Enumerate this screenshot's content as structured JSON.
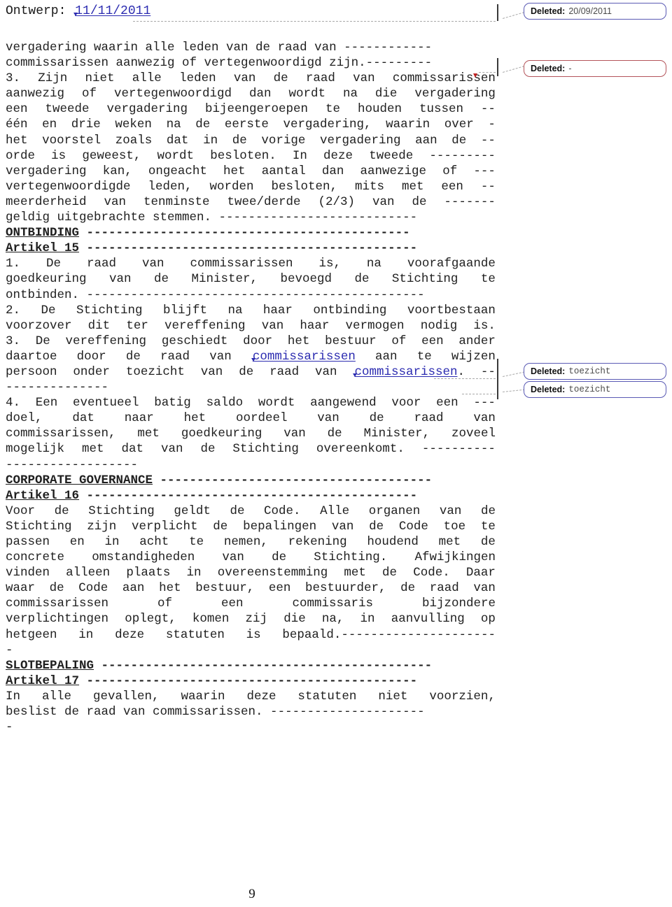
{
  "document": {
    "header": {
      "label": "Ontwerp:",
      "inserted_date": "11/11/2011"
    },
    "page_number": "9",
    "lines": [
      {
        "id": "l01",
        "type": "plain",
        "text": "vergadering waarin alle leden van de raad van ------------"
      },
      {
        "id": "l02",
        "type": "plain",
        "text": "commissarissen aanwezig of vertegenwoordigd zijn.---------"
      },
      {
        "id": "l03",
        "type": "justify",
        "words": [
          "3.",
          "Zijn",
          "niet",
          "alle",
          "leden",
          "van",
          "de",
          "raad",
          "van",
          "commissarissen"
        ]
      },
      {
        "id": "l04",
        "type": "justify",
        "words": [
          "aanwezig",
          "of",
          "vertegenwoordigd",
          "dan",
          "wordt",
          "na",
          "die",
          "vergadering"
        ]
      },
      {
        "id": "l05",
        "type": "justify",
        "words": [
          "een",
          "tweede",
          "vergadering",
          "bijeengeroepen",
          "te",
          "houden",
          "tussen",
          "--"
        ]
      },
      {
        "id": "l06",
        "type": "justify",
        "words": [
          "één",
          "en",
          "drie",
          "weken",
          "na",
          "de",
          "eerste",
          "vergadering,",
          "waarin",
          "over",
          "-"
        ]
      },
      {
        "id": "l07",
        "type": "justify",
        "words": [
          "het",
          "voorstel",
          "zoals",
          "dat",
          "in",
          "de",
          "vorige",
          "vergadering",
          "aan",
          "de",
          "--"
        ]
      },
      {
        "id": "l08",
        "type": "justify",
        "words": [
          "orde",
          "is",
          "geweest,",
          "wordt",
          "besloten.",
          "In",
          "deze",
          "tweede",
          "---------"
        ]
      },
      {
        "id": "l09",
        "type": "justify",
        "words": [
          "vergadering",
          "kan,",
          "ongeacht",
          "het",
          "aantal",
          "dan",
          "aanwezige",
          "of",
          "---"
        ]
      },
      {
        "id": "l10",
        "type": "justify",
        "words": [
          "vertegenwoordigde",
          "leden,",
          "worden",
          "besloten,",
          "mits",
          "met",
          "een",
          "--"
        ]
      },
      {
        "id": "l11",
        "type": "justify",
        "words": [
          "meerderheid",
          "van",
          "tenminste",
          "twee/derde",
          "(2/3)",
          "van",
          "de",
          "-------"
        ]
      },
      {
        "id": "l12",
        "type": "plain",
        "text": "geldig uitgebrachte stemmen. ---------------------------"
      },
      {
        "id": "l13",
        "type": "heading",
        "heading": "ONTBINDING",
        "rule": " --------------------------------------------"
      },
      {
        "id": "l14",
        "type": "heading",
        "heading": "Artikel 15",
        "rule": " ---------------------------------------------"
      },
      {
        "id": "l15",
        "type": "justify",
        "words": [
          "1.",
          "De",
          "raad",
          "van",
          "commissarissen",
          "is,",
          "na",
          "voorafgaande"
        ]
      },
      {
        "id": "l16",
        "type": "justify",
        "words": [
          "goedkeuring",
          "van",
          "de",
          "Minister,",
          "bevoegd",
          "de",
          "Stichting",
          "te"
        ]
      },
      {
        "id": "l17",
        "type": "plain",
        "text": "ontbinden. ----------------------------------------------"
      },
      {
        "id": "l18",
        "type": "justify",
        "words": [
          "2.",
          "De",
          "Stichting",
          "blijft",
          "na",
          "haar",
          "ontbinding",
          "voortbestaan"
        ]
      },
      {
        "id": "l19",
        "type": "justify",
        "words": [
          "voorzover",
          "dit",
          "ter",
          "vereffening",
          "van",
          "haar",
          "vermogen",
          "nodig",
          "is."
        ]
      },
      {
        "id": "l20",
        "type": "justify",
        "words": [
          "3.",
          "De",
          "vereffening",
          "geschiedt",
          "door",
          "het",
          "bestuur",
          "of",
          "een",
          "ander"
        ]
      },
      {
        "id": "l21",
        "type": "justify-ins",
        "words": [
          "daartoe",
          "door",
          "de",
          "raad",
          "van",
          "§commissarissen",
          "aan",
          "te",
          "wijzen"
        ]
      },
      {
        "id": "l22",
        "type": "justify-ins",
        "words": [
          "persoon",
          "onder",
          "toezicht",
          "van",
          "de",
          "raad",
          "van",
          "§commissarissen.",
          "--"
        ]
      },
      {
        "id": "l23",
        "type": "plain",
        "text": "--------------"
      },
      {
        "id": "l24",
        "type": "justify",
        "words": [
          "4.",
          "Een",
          "eventueel",
          "batig",
          "saldo",
          "wordt",
          "aangewend",
          "voor",
          "een",
          "---"
        ]
      },
      {
        "id": "l25",
        "type": "justify",
        "words": [
          "doel,",
          "dat",
          "naar",
          "het",
          "oordeel",
          "van",
          "de",
          "raad",
          "van"
        ]
      },
      {
        "id": "l26",
        "type": "justify",
        "words": [
          "commissarissen,",
          "met",
          "goedkeuring",
          "van",
          "de",
          "Minister,",
          "zoveel"
        ]
      },
      {
        "id": "l27",
        "type": "justify",
        "words": [
          "mogelijk",
          "met",
          "dat",
          "van",
          "de",
          "Stichting",
          "overeenkomt.",
          "----------"
        ]
      },
      {
        "id": "l28",
        "type": "plain",
        "text": "------------------"
      },
      {
        "id": "l29",
        "type": "heading",
        "heading": "CORPORATE GOVERNANCE",
        "rule": " -------------------------------------"
      },
      {
        "id": "l30",
        "type": "heading",
        "heading": "Artikel 16",
        "rule": " ---------------------------------------------"
      },
      {
        "id": "l31",
        "type": "justify",
        "words": [
          "Voor",
          "de",
          "Stichting",
          "geldt",
          "de",
          "Code.",
          "Alle",
          "organen",
          "van",
          "de"
        ]
      },
      {
        "id": "l32",
        "type": "justify",
        "words": [
          "Stichting",
          "zijn",
          "verplicht",
          "de",
          "bepalingen",
          "van",
          "de",
          "Code",
          "toe",
          "te"
        ]
      },
      {
        "id": "l33",
        "type": "justify",
        "words": [
          "passen",
          "en",
          "in",
          "acht",
          "te",
          "nemen,",
          "rekening",
          "houdend",
          "met",
          "de"
        ]
      },
      {
        "id": "l34",
        "type": "justify",
        "words": [
          "concrete",
          "omstandigheden",
          "van",
          "de",
          "Stichting.",
          "Afwijkingen"
        ]
      },
      {
        "id": "l35",
        "type": "justify",
        "words": [
          "vinden",
          "alleen",
          "plaats",
          "in",
          "overeenstemming",
          "met",
          "de",
          "Code.",
          "Daar"
        ]
      },
      {
        "id": "l36",
        "type": "justify",
        "words": [
          "waar",
          "de",
          "Code",
          "aan",
          "het",
          "bestuur,",
          "een",
          "bestuurder,",
          "de",
          "raad",
          "van"
        ]
      },
      {
        "id": "l37",
        "type": "justify",
        "words": [
          "commissarissen",
          "of",
          "een",
          "commissaris",
          "bijzondere"
        ]
      },
      {
        "id": "l38",
        "type": "justify",
        "words": [
          "verplichtingen",
          "oplegt,",
          "komen",
          "zij",
          "die",
          "na,",
          "in",
          "aanvulling",
          "op"
        ]
      },
      {
        "id": "l39",
        "type": "justify",
        "words": [
          "hetgeen",
          "in",
          "deze",
          "statuten",
          "is",
          "bepaald.---------------------"
        ]
      },
      {
        "id": "l40",
        "type": "plain",
        "text": "-"
      },
      {
        "id": "l41",
        "type": "heading",
        "heading": "SLOTBEPALING",
        "rule": " ---------------------------------------------"
      },
      {
        "id": "l42",
        "type": "heading",
        "heading": "Artikel 17",
        "rule": " ---------------------------------------------"
      },
      {
        "id": "l43",
        "type": "justify",
        "words": [
          "In",
          "alle",
          "gevallen,",
          "waarin",
          "deze",
          "statuten",
          "niet",
          "voorzien,"
        ]
      },
      {
        "id": "l44",
        "type": "plain",
        "text": "beslist de raad van commissarissen. ---------------------"
      },
      {
        "id": "l45",
        "type": "plain",
        "text": "-"
      }
    ],
    "revisions": [
      {
        "id": "rev1",
        "label": "Deleted:",
        "value": "20/09/2011",
        "color": "#5a5ab4",
        "value_font": "sans"
      },
      {
        "id": "rev2",
        "label": "Deleted:",
        "value": "-",
        "color": "#b4545a",
        "value_font": "sans"
      },
      {
        "id": "rev3",
        "label": "Deleted:",
        "value": "toezicht",
        "color": "#5a5ab4",
        "value_font": "mono"
      },
      {
        "id": "rev4",
        "label": "Deleted:",
        "value": "toezicht",
        "color": "#5a5ab4",
        "value_font": "mono"
      }
    ]
  }
}
